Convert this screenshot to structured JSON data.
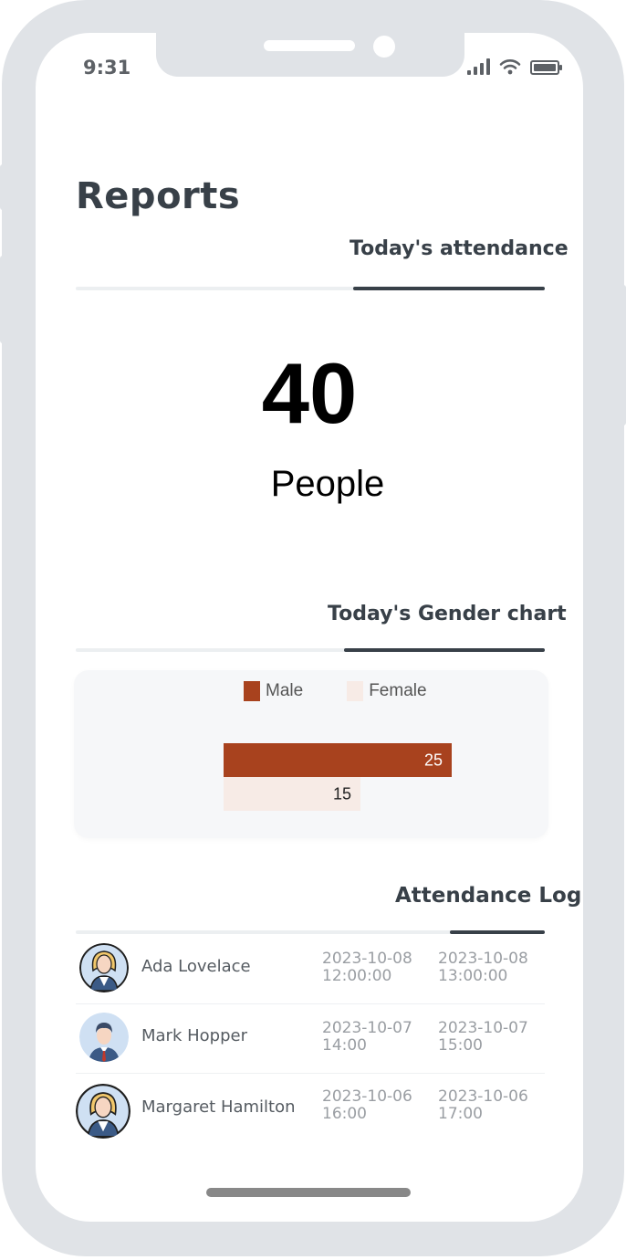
{
  "status_bar": {
    "time": "9:31"
  },
  "page": {
    "title": "Reports"
  },
  "attendance": {
    "tab_label": "Today's attendance",
    "count": "40",
    "unit": "People"
  },
  "gender_chart": {
    "tab_label": "Today's Gender chart",
    "legend": {
      "male": "Male",
      "female": "Female"
    },
    "bar_labels": {
      "male": "25",
      "female": "15"
    }
  },
  "chart_data": {
    "type": "bar",
    "orientation": "horizontal",
    "categories": [
      ""
    ],
    "series": [
      {
        "name": "Male",
        "values": [
          25
        ],
        "color": "#a8421e"
      },
      {
        "name": "Female",
        "values": [
          15
        ],
        "color": "#f7ebe6"
      }
    ],
    "legend_position": "top",
    "grid": false
  },
  "log": {
    "tab_label": "Attendance Log",
    "entries": [
      {
        "name": "Ada Lovelace",
        "check_in": "2023-10-08 12:00:00",
        "check_out": "2023-10-08 13:00:00",
        "avatar": "woman-avatar-icon"
      },
      {
        "name": "Mark Hopper",
        "check_in": "2023-10-07 14:00",
        "check_out": "2023-10-07 15:00",
        "avatar": "man-avatar-icon"
      },
      {
        "name": "Margaret Hamilton",
        "check_in": "2023-10-06 16:00",
        "check_out": "2023-10-06 17:00",
        "avatar": "woman-avatar-icon"
      }
    ]
  },
  "colors": {
    "accent": "#a8421e",
    "female": "#f7ebe6",
    "text_dark": "#384048",
    "frame": "#e0e3e7"
  }
}
